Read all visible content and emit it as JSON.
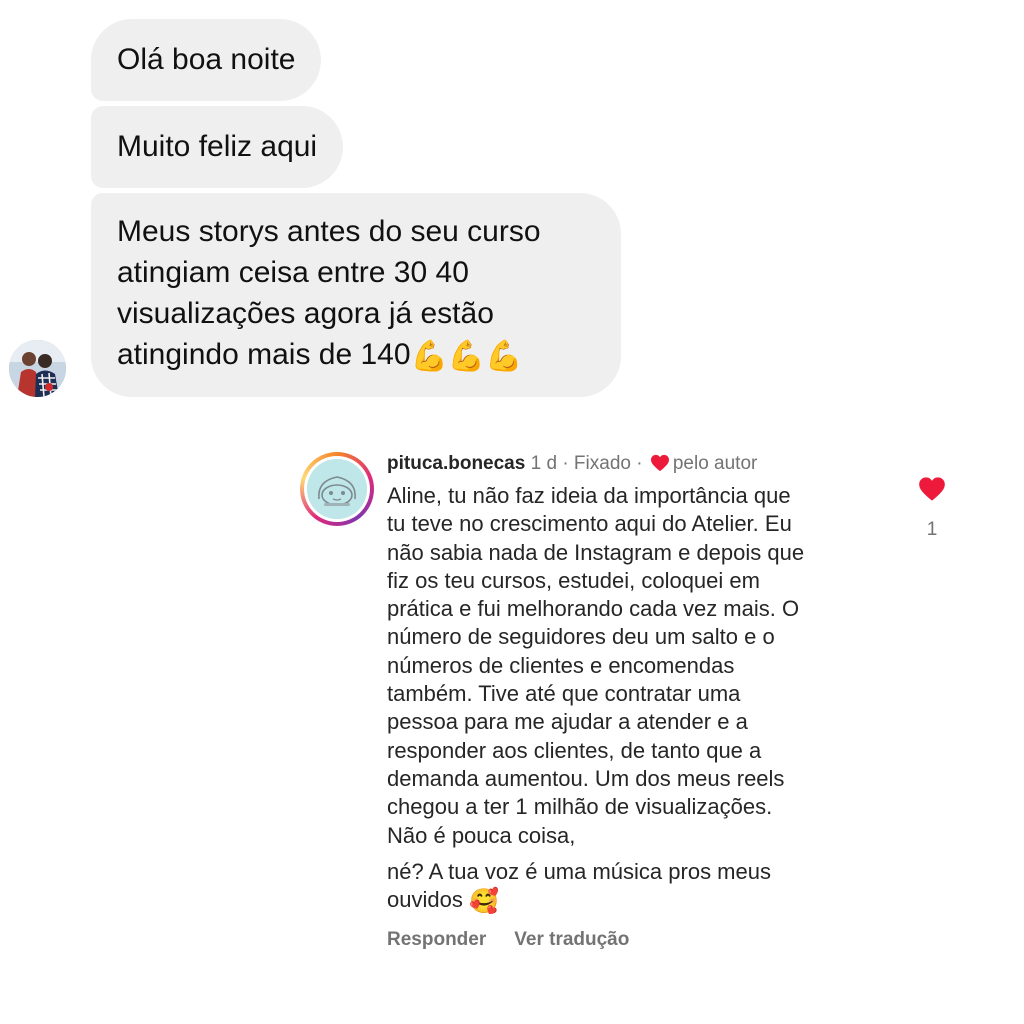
{
  "chat": {
    "messages": [
      {
        "text": "Olá boa noite"
      },
      {
        "text": "Muito feliz aqui"
      },
      {
        "lines": [
          "Meus storys antes do seu curso",
          "atingiam ceisa entre 30 40",
          "visualizações agora já estão",
          "atingindo mais de 140"
        ],
        "emoji": "💪💪💪"
      }
    ],
    "avatar_icon": "user-photo-avatar"
  },
  "comment": {
    "username": "pituca.bonecas",
    "time": "1 d",
    "sep1": "·",
    "pinned_label": "Fixado",
    "sep2": "·",
    "liked_by_author": "pelo autor",
    "body_lines": [
      "Aline, tu não faz ideia da importância que",
      "tu teve no crescimento aqui do Atelier. Eu",
      "não sabia nada de Instagram e depois que",
      "fiz os teu cursos, estudei, coloquei em",
      "prática e fui melhorando cada vez mais. O",
      "número de seguidores deu um salto e o",
      "números de clientes e encomendas",
      "também. Tive até que contratar uma",
      "pessoa para me ajudar a atender e a",
      "responder aos clientes, de tanto que a",
      "demanda aumentou. Um dos meus reels",
      "chegou a ter 1 milhão de visualizações.",
      "Não é pouca coisa,"
    ],
    "body_lines_2": [
      "né? A tua voz é uma música pros meus"
    ],
    "last_line_text": "ouvidos",
    "last_line_emoji": "🥰",
    "reply_label": "Responder",
    "translate_label": "Ver tradução",
    "like_count": "1",
    "heart_color": "#ed1a3b",
    "secondary_text_color": "#737373"
  }
}
